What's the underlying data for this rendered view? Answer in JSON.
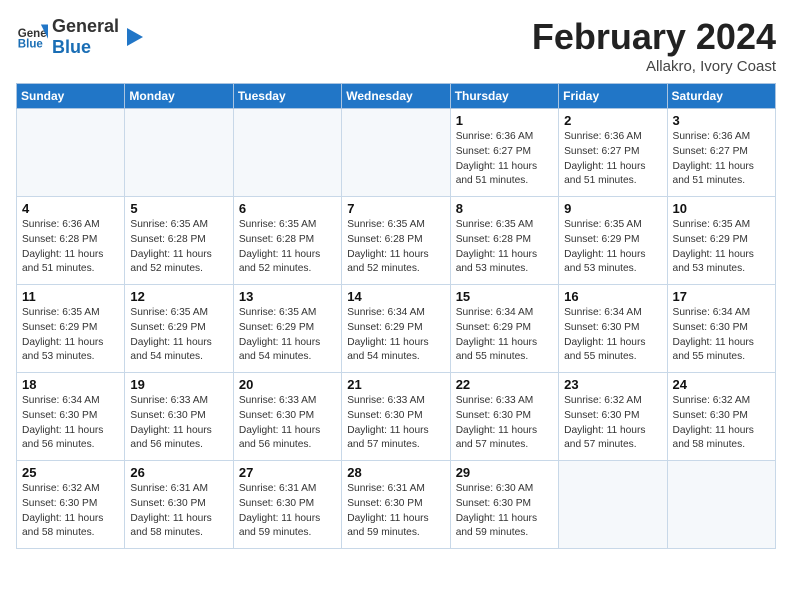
{
  "header": {
    "logo_line1": "General",
    "logo_line2": "Blue",
    "month": "February 2024",
    "location": "Allakro, Ivory Coast"
  },
  "weekdays": [
    "Sunday",
    "Monday",
    "Tuesday",
    "Wednesday",
    "Thursday",
    "Friday",
    "Saturday"
  ],
  "weeks": [
    [
      {
        "day": "",
        "info": ""
      },
      {
        "day": "",
        "info": ""
      },
      {
        "day": "",
        "info": ""
      },
      {
        "day": "",
        "info": ""
      },
      {
        "day": "1",
        "info": "Sunrise: 6:36 AM\nSunset: 6:27 PM\nDaylight: 11 hours\nand 51 minutes."
      },
      {
        "day": "2",
        "info": "Sunrise: 6:36 AM\nSunset: 6:27 PM\nDaylight: 11 hours\nand 51 minutes."
      },
      {
        "day": "3",
        "info": "Sunrise: 6:36 AM\nSunset: 6:27 PM\nDaylight: 11 hours\nand 51 minutes."
      }
    ],
    [
      {
        "day": "4",
        "info": "Sunrise: 6:36 AM\nSunset: 6:28 PM\nDaylight: 11 hours\nand 51 minutes."
      },
      {
        "day": "5",
        "info": "Sunrise: 6:35 AM\nSunset: 6:28 PM\nDaylight: 11 hours\nand 52 minutes."
      },
      {
        "day": "6",
        "info": "Sunrise: 6:35 AM\nSunset: 6:28 PM\nDaylight: 11 hours\nand 52 minutes."
      },
      {
        "day": "7",
        "info": "Sunrise: 6:35 AM\nSunset: 6:28 PM\nDaylight: 11 hours\nand 52 minutes."
      },
      {
        "day": "8",
        "info": "Sunrise: 6:35 AM\nSunset: 6:28 PM\nDaylight: 11 hours\nand 53 minutes."
      },
      {
        "day": "9",
        "info": "Sunrise: 6:35 AM\nSunset: 6:29 PM\nDaylight: 11 hours\nand 53 minutes."
      },
      {
        "day": "10",
        "info": "Sunrise: 6:35 AM\nSunset: 6:29 PM\nDaylight: 11 hours\nand 53 minutes."
      }
    ],
    [
      {
        "day": "11",
        "info": "Sunrise: 6:35 AM\nSunset: 6:29 PM\nDaylight: 11 hours\nand 53 minutes."
      },
      {
        "day": "12",
        "info": "Sunrise: 6:35 AM\nSunset: 6:29 PM\nDaylight: 11 hours\nand 54 minutes."
      },
      {
        "day": "13",
        "info": "Sunrise: 6:35 AM\nSunset: 6:29 PM\nDaylight: 11 hours\nand 54 minutes."
      },
      {
        "day": "14",
        "info": "Sunrise: 6:34 AM\nSunset: 6:29 PM\nDaylight: 11 hours\nand 54 minutes."
      },
      {
        "day": "15",
        "info": "Sunrise: 6:34 AM\nSunset: 6:29 PM\nDaylight: 11 hours\nand 55 minutes."
      },
      {
        "day": "16",
        "info": "Sunrise: 6:34 AM\nSunset: 6:30 PM\nDaylight: 11 hours\nand 55 minutes."
      },
      {
        "day": "17",
        "info": "Sunrise: 6:34 AM\nSunset: 6:30 PM\nDaylight: 11 hours\nand 55 minutes."
      }
    ],
    [
      {
        "day": "18",
        "info": "Sunrise: 6:34 AM\nSunset: 6:30 PM\nDaylight: 11 hours\nand 56 minutes."
      },
      {
        "day": "19",
        "info": "Sunrise: 6:33 AM\nSunset: 6:30 PM\nDaylight: 11 hours\nand 56 minutes."
      },
      {
        "day": "20",
        "info": "Sunrise: 6:33 AM\nSunset: 6:30 PM\nDaylight: 11 hours\nand 56 minutes."
      },
      {
        "day": "21",
        "info": "Sunrise: 6:33 AM\nSunset: 6:30 PM\nDaylight: 11 hours\nand 57 minutes."
      },
      {
        "day": "22",
        "info": "Sunrise: 6:33 AM\nSunset: 6:30 PM\nDaylight: 11 hours\nand 57 minutes."
      },
      {
        "day": "23",
        "info": "Sunrise: 6:32 AM\nSunset: 6:30 PM\nDaylight: 11 hours\nand 57 minutes."
      },
      {
        "day": "24",
        "info": "Sunrise: 6:32 AM\nSunset: 6:30 PM\nDaylight: 11 hours\nand 58 minutes."
      }
    ],
    [
      {
        "day": "25",
        "info": "Sunrise: 6:32 AM\nSunset: 6:30 PM\nDaylight: 11 hours\nand 58 minutes."
      },
      {
        "day": "26",
        "info": "Sunrise: 6:31 AM\nSunset: 6:30 PM\nDaylight: 11 hours\nand 58 minutes."
      },
      {
        "day": "27",
        "info": "Sunrise: 6:31 AM\nSunset: 6:30 PM\nDaylight: 11 hours\nand 59 minutes."
      },
      {
        "day": "28",
        "info": "Sunrise: 6:31 AM\nSunset: 6:30 PM\nDaylight: 11 hours\nand 59 minutes."
      },
      {
        "day": "29",
        "info": "Sunrise: 6:30 AM\nSunset: 6:30 PM\nDaylight: 11 hours\nand 59 minutes."
      },
      {
        "day": "",
        "info": ""
      },
      {
        "day": "",
        "info": ""
      }
    ]
  ]
}
